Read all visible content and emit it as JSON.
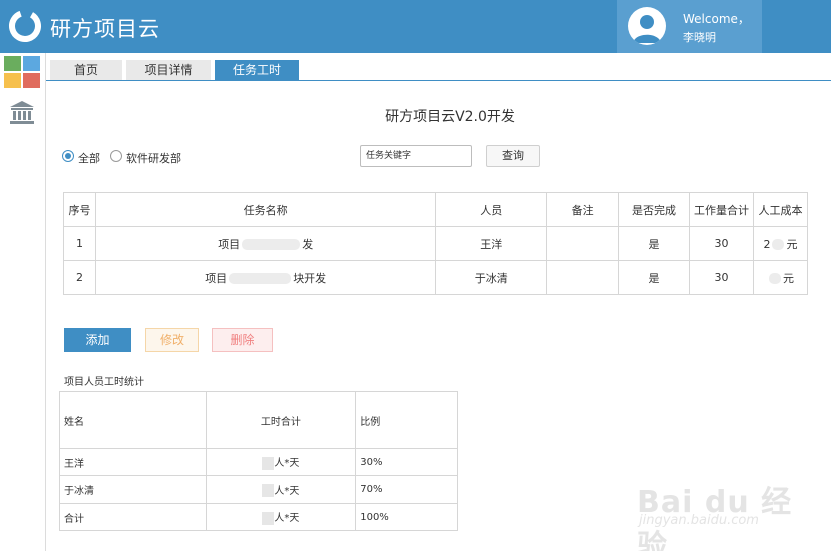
{
  "app": {
    "title": "研方项目云",
    "welcome": "Welcome，",
    "username": "李晓明"
  },
  "colors": {
    "primary": "#3f8ec4",
    "header": "#3f8ec4",
    "tile_green": "#6aad5e",
    "tile_blue": "#5ca8e0",
    "tile_yellow": "#f6c04d",
    "tile_red": "#e06c5e",
    "edit_text": "#f0b06a",
    "delete_text": "#f08080"
  },
  "icons": {
    "logo": "ring-logo-icon",
    "avatar": "user-avatar-icon",
    "apps": "app-tiles-icon",
    "bank": "bank-building-icon"
  },
  "tabs": [
    {
      "label": "首页",
      "active": false
    },
    {
      "label": "项目详情",
      "active": false
    },
    {
      "label": "任务工时",
      "active": true
    }
  ],
  "page": {
    "title": "研方项目云V2.0开发"
  },
  "filters": {
    "options": [
      {
        "label": "全部",
        "checked": true
      },
      {
        "label": "软件研发部",
        "checked": false
      }
    ],
    "search_placeholder": "任务关键字",
    "query_label": "查询"
  },
  "task_table": {
    "headers": [
      "序号",
      "任务名称",
      "人员",
      "备注",
      "是否完成",
      "工作量合计",
      "人工成本"
    ],
    "rows": [
      {
        "index": "1",
        "name_start": "项目",
        "name_end": "发",
        "person": "王洋",
        "note": "",
        "done": "是",
        "workload": "30",
        "cost_start": "2",
        "cost_end": "元"
      },
      {
        "index": "2",
        "name_start": "项目",
        "name_end": "块开发",
        "person": "于冰清",
        "note": "",
        "done": "是",
        "workload": "30",
        "cost_start": "",
        "cost_end": "元"
      }
    ]
  },
  "actions": {
    "add": "添加",
    "edit": "修改",
    "delete": "删除"
  },
  "stats": {
    "title": "项目人员工时统计",
    "headers": [
      "姓名",
      "工时合计",
      "比例"
    ],
    "rows": [
      {
        "name": "王洋",
        "hours": "人*天",
        "ratio": "30%"
      },
      {
        "name": "于冰清",
        "hours": "人*天",
        "ratio": "70%"
      },
      {
        "name": "合计",
        "hours": "人*天",
        "ratio": "100%"
      }
    ]
  },
  "watermark": {
    "brand": "Bai du 经验",
    "url": "jingyan.baidu.com"
  }
}
